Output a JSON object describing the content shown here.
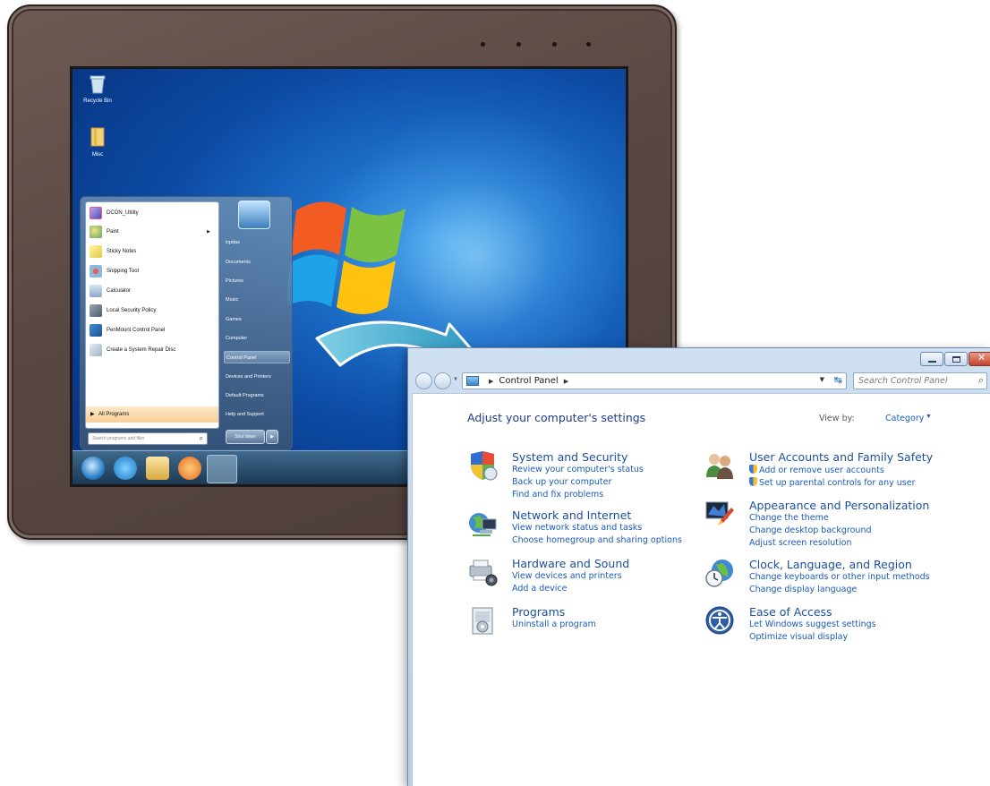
{
  "colors": {
    "bezel": "#594743",
    "desktop_blue": "#1b6cc6",
    "link_blue": "#1a5ab8",
    "category_title": "#1b4f9c",
    "heading": "#1e3b8a",
    "arrow_teal": "#3aa6c8"
  },
  "desktop": {
    "icons": [
      {
        "label": "Recycle Bin",
        "icon": "recycle-bin-icon"
      },
      {
        "label": "Misc",
        "icon": "folder-icon"
      }
    ]
  },
  "start_menu": {
    "left_items": [
      {
        "label": "DCON_Utility",
        "icon": "dcon-utility-icon"
      },
      {
        "label": "Paint",
        "icon": "paint-icon",
        "has_submenu": true
      },
      {
        "label": "Sticky Notes",
        "icon": "sticky-notes-icon"
      },
      {
        "label": "Snipping Tool",
        "icon": "snipping-tool-icon"
      },
      {
        "label": "Calculator",
        "icon": "calculator-icon"
      },
      {
        "label": "Local Security Policy",
        "icon": "security-policy-icon"
      },
      {
        "label": "PenMount Control Panel",
        "icon": "penmount-icon"
      },
      {
        "label": "Create a System Repair Disc",
        "icon": "repair-disc-icon"
      }
    ],
    "all_programs": "All Programs",
    "search_placeholder": "Search programs and files",
    "right_items": [
      "icpdas",
      "Documents",
      "Pictures",
      "Music",
      "Games",
      "Computer",
      "Control Panel",
      "Devices and Printers",
      "Default Programs",
      "Help and Support"
    ],
    "highlighted_right_item": "Control Panel",
    "shutdown_label": "Shut down"
  },
  "taskbar": {
    "buttons": [
      "start-orb-icon",
      "ie-icon",
      "explorer-icon",
      "media-player-icon",
      "paint-icon"
    ]
  },
  "control_panel": {
    "breadcrumb": [
      "Control Panel"
    ],
    "search_placeholder": "Search Control Panel",
    "heading": "Adjust your computer's settings",
    "view_by_label": "View by:",
    "view_by_value": "Category",
    "categories_left": [
      {
        "title": "System and Security",
        "icon": "system-security-icon",
        "links": [
          "Review your computer's status",
          "Back up your computer",
          "Find and fix problems"
        ]
      },
      {
        "title": "Network and Internet",
        "icon": "network-internet-icon",
        "links": [
          "View network status and tasks",
          "Choose homegroup and sharing options"
        ]
      },
      {
        "title": "Hardware and Sound",
        "icon": "hardware-sound-icon",
        "links": [
          "View devices and printers",
          "Add a device"
        ]
      },
      {
        "title": "Programs",
        "icon": "programs-icon",
        "links": [
          "Uninstall a program"
        ]
      }
    ],
    "categories_right": [
      {
        "title": "User Accounts and Family Safety",
        "icon": "user-accounts-icon",
        "links": [
          "Add or remove user accounts",
          "Set up parental controls for any user"
        ],
        "shielded_links": true
      },
      {
        "title": "Appearance and Personalization",
        "icon": "appearance-icon",
        "links": [
          "Change the theme",
          "Change desktop background",
          "Adjust screen resolution"
        ]
      },
      {
        "title": "Clock, Language, and Region",
        "icon": "clock-language-icon",
        "links": [
          "Change keyboards or other input methods",
          "Change display language"
        ]
      },
      {
        "title": "Ease of Access",
        "icon": "ease-of-access-icon",
        "links": [
          "Let Windows suggest settings",
          "Optimize visual display"
        ]
      }
    ]
  }
}
